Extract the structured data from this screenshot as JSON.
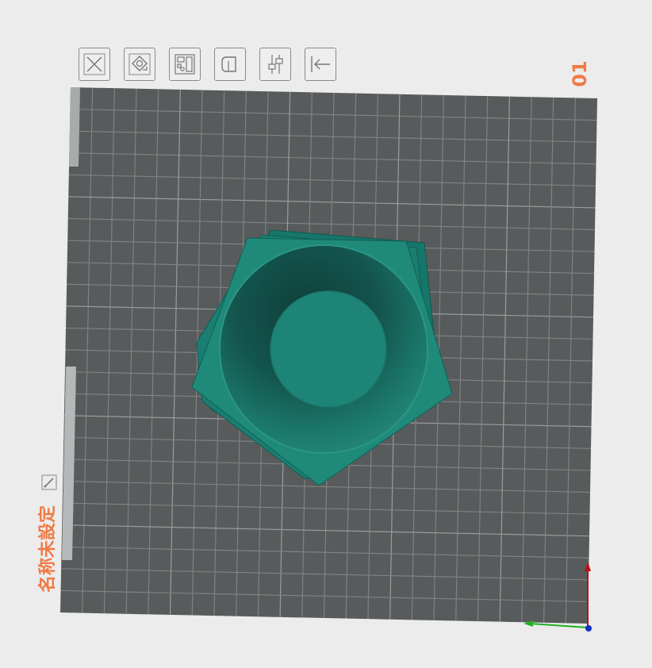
{
  "plate": {
    "number": "01",
    "name": "名称未設定"
  },
  "toolbar": {
    "buttons": [
      {
        "name": "close-button",
        "icon": "close-x-icon"
      },
      {
        "name": "auto-orient-button",
        "icon": "auto-orient-icon"
      },
      {
        "name": "arrange-button",
        "icon": "arrange-grid-icon"
      },
      {
        "name": "lock-button",
        "icon": "lock-icon"
      },
      {
        "name": "settings-button",
        "icon": "sliders-icon"
      },
      {
        "name": "back-button",
        "icon": "arrow-left-bar-icon"
      }
    ]
  },
  "colors": {
    "accent": "#f07a45",
    "plate": "#585b5b",
    "grid": "#7d8080",
    "model": "#1f8a7a",
    "model_dark": "#0f4f48",
    "axis_x": "#1fb01f",
    "axis_z": "#c01010",
    "axis_origin": "#1030c0"
  }
}
